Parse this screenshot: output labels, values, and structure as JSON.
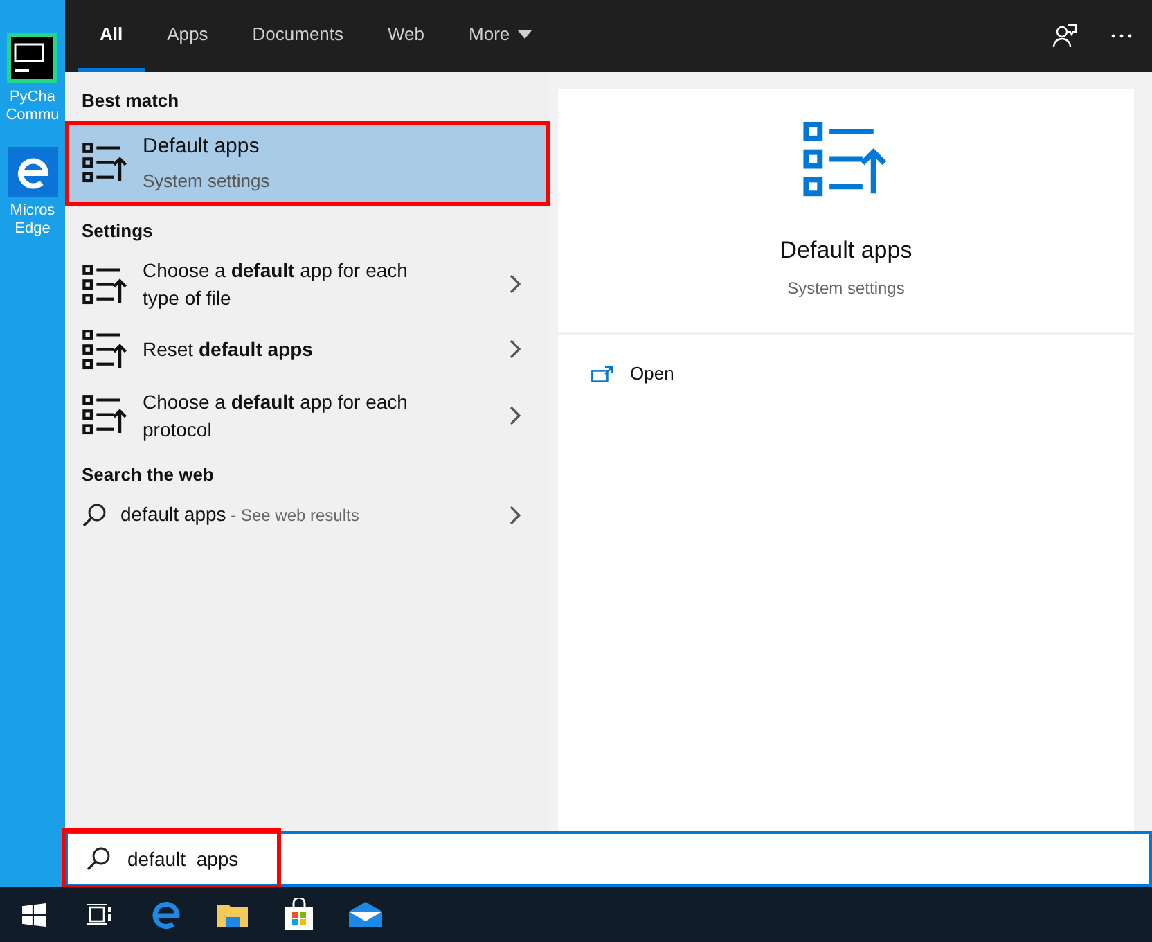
{
  "desktop_icons": [
    {
      "kind": "pycharm",
      "label_lines": [
        "PyCha",
        "Commu"
      ]
    },
    {
      "kind": "edge",
      "label_lines": [
        "Micros",
        "Edge"
      ]
    }
  ],
  "tabs": [
    {
      "label": "All",
      "selected": true
    },
    {
      "label": "Apps",
      "selected": false
    },
    {
      "label": "Documents",
      "selected": false
    },
    {
      "label": "Web",
      "selected": false
    },
    {
      "label": "More",
      "selected": false,
      "dropdown": true
    }
  ],
  "sections": [
    {
      "heading": "Best match",
      "items": [
        {
          "kind": "best",
          "title": "Default apps",
          "subtitle": "System settings",
          "selected": true,
          "highlighted": true
        }
      ]
    },
    {
      "heading": "Settings",
      "items": [
        {
          "kind": "setting",
          "title": "Choose a **default** app for each type of file",
          "selected": false
        },
        {
          "kind": "setting",
          "title": "Reset **default apps**",
          "selected": false
        },
        {
          "kind": "setting",
          "title": "Choose a **default** app for each protocol",
          "selected": false
        }
      ]
    },
    {
      "heading": "Search the web",
      "items": [
        {
          "kind": "web",
          "title": "default apps",
          "suffix": " - See web results",
          "selected": false
        }
      ]
    }
  ],
  "preview": {
    "title": "Default apps",
    "subtitle": "System settings",
    "actions": [
      {
        "label": "Open"
      }
    ]
  },
  "search": {
    "value": "default  apps",
    "highlighted": true
  },
  "taskbar": [
    {
      "kind": "start"
    },
    {
      "kind": "taskview"
    },
    {
      "kind": "edge"
    },
    {
      "kind": "explorer"
    },
    {
      "kind": "store"
    },
    {
      "kind": "mail"
    }
  ]
}
